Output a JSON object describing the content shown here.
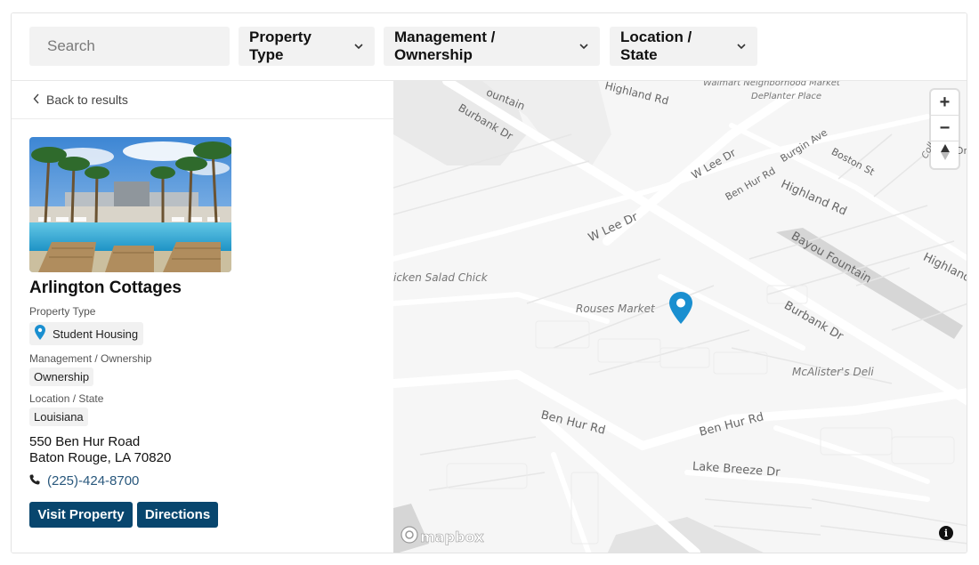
{
  "filters": {
    "search_placeholder": "Search",
    "property_type": "Property Type",
    "management": "Management / Ownership",
    "location": "Location / State"
  },
  "sidebar": {
    "back_label": "Back to results",
    "property": {
      "name": "Arlington Cottages",
      "type_label": "Property Type",
      "type_value": "Student Housing",
      "mgmt_label": "Management / Ownership",
      "mgmt_value": "Ownership",
      "loc_label": "Location / State",
      "loc_value": "Louisiana",
      "address_line1": "550 Ben Hur Road",
      "address_line2": "Baton Rouge, LA 70820",
      "phone": "(225)-424-8700"
    },
    "buttons": {
      "visit": "Visit Property",
      "directions": "Directions"
    }
  },
  "map": {
    "place_labels": {
      "walmart": "Walmart Neighborhood Market",
      "deplanter": "DePlanter Place",
      "rouses": "Rouses Market",
      "mcalisters": "McAlister's Deli",
      "chicken": "icken Salad Chick",
      "college": "College H"
    },
    "road_labels": {
      "burbank_top": "Burbank Dr",
      "highland_top": "Highland Rd",
      "fountain_top": "ountain",
      "w_lee_1": "W Lee Dr",
      "w_lee_2": "W Lee Dr",
      "ben_hur_top": "Ben Hur Rd",
      "burgin": "Burgin Ave",
      "boston": "Boston St",
      "highland_mid": "Highland Rd",
      "bayou": "Bayou Fountain",
      "highland_right": "Highland",
      "burbank_mid": "Burbank Dr",
      "ben_hur_left": "Ben Hur Rd",
      "ben_hur_right": "Ben Hur Rd",
      "lake_breeze": "Lake Breeze Dr",
      "dr_edge": "Dr"
    },
    "zoom_in": "+",
    "zoom_out": "−",
    "attribution": "i",
    "logo_text": "mapbox",
    "pin_color": "#1a8fd0"
  }
}
